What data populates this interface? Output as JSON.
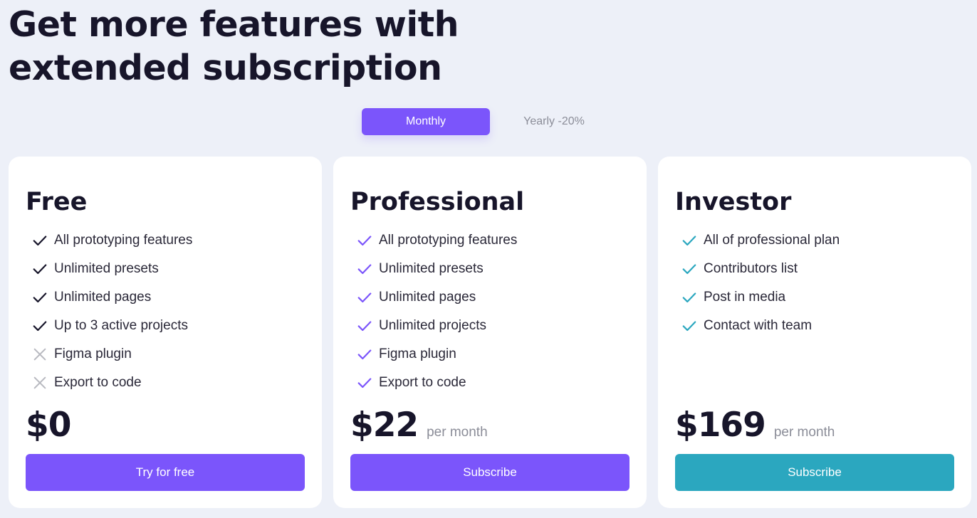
{
  "headline": {
    "line1": "Get more features with",
    "line2": "extended subscription"
  },
  "billing_toggle": {
    "monthly_label": "Monthly",
    "yearly_label": "Yearly -20%",
    "selected": "monthly"
  },
  "colors": {
    "accent_violet": "#7b55fb",
    "accent_teal": "#2ba7bf",
    "included_default": "#17152a",
    "excluded": "#b8b9c0"
  },
  "plans": [
    {
      "name": "Free",
      "features": [
        {
          "label": "All prototyping features",
          "included": true,
          "icon": "check-icon"
        },
        {
          "label": "Unlimited presets",
          "included": true,
          "icon": "check-icon"
        },
        {
          "label": "Unlimited pages",
          "included": true,
          "icon": "check-icon"
        },
        {
          "label": "Up to 3 active projects",
          "included": true,
          "icon": "check-icon"
        },
        {
          "label": "Figma plugin",
          "included": false,
          "icon": "cross-icon"
        },
        {
          "label": "Export to code",
          "included": false,
          "icon": "cross-icon"
        }
      ],
      "price": "$0",
      "period": "",
      "cta_label": "Try for free"
    },
    {
      "name": "Professional",
      "features": [
        {
          "label": "All prototyping features",
          "included": true,
          "icon": "check-icon"
        },
        {
          "label": "Unlimited presets",
          "included": true,
          "icon": "check-icon"
        },
        {
          "label": "Unlimited pages",
          "included": true,
          "icon": "check-icon"
        },
        {
          "label": "Unlimited projects",
          "included": true,
          "icon": "check-icon"
        },
        {
          "label": "Figma plugin",
          "included": true,
          "icon": "check-icon"
        },
        {
          "label": "Export to code",
          "included": true,
          "icon": "check-icon"
        }
      ],
      "price": "$22",
      "period": "per month",
      "cta_label": "Subscribe"
    },
    {
      "name": "Investor",
      "features": [
        {
          "label": "All of professional plan",
          "included": true,
          "icon": "check-icon"
        },
        {
          "label": "Contributors list",
          "included": true,
          "icon": "check-icon"
        },
        {
          "label": "Post in media",
          "included": true,
          "icon": "check-icon"
        },
        {
          "label": "Contact with team",
          "included": true,
          "icon": "check-icon"
        }
      ],
      "price": "$169",
      "period": "per month",
      "cta_label": "Subscribe"
    }
  ]
}
